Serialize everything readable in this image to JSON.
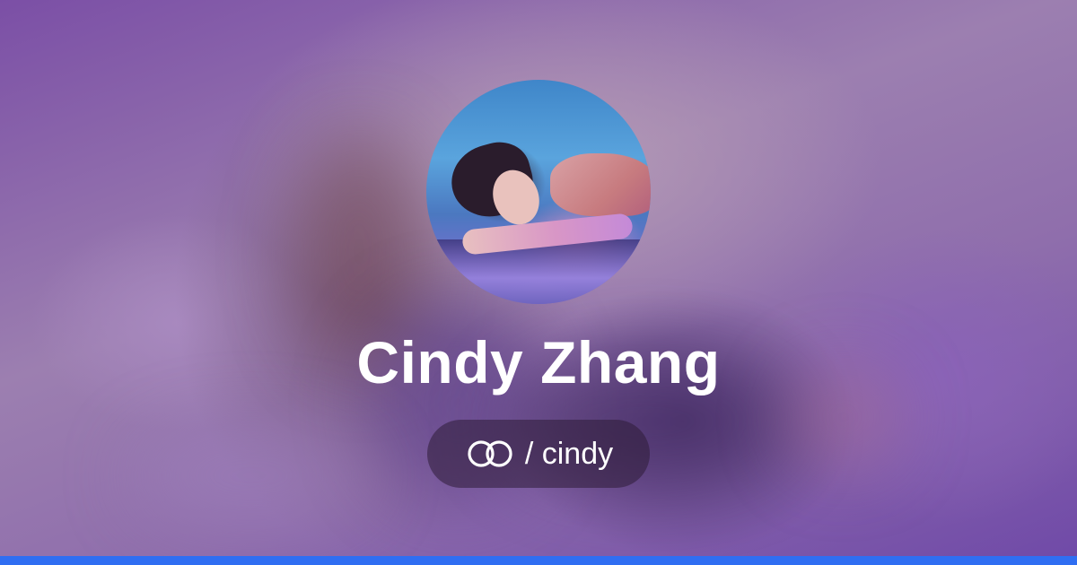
{
  "profile": {
    "name": "Cindy Zhang",
    "handle": "/ cindy",
    "avatar_alt": "profile photo"
  },
  "icons": {
    "brand": "interlocking-rings-icon"
  },
  "colors": {
    "accent_bar": "#2f6ef2",
    "text": "#ffffff",
    "pill_background": "rgba(45, 28, 55, 0.55)",
    "backdrop": "#8a6fa0"
  }
}
